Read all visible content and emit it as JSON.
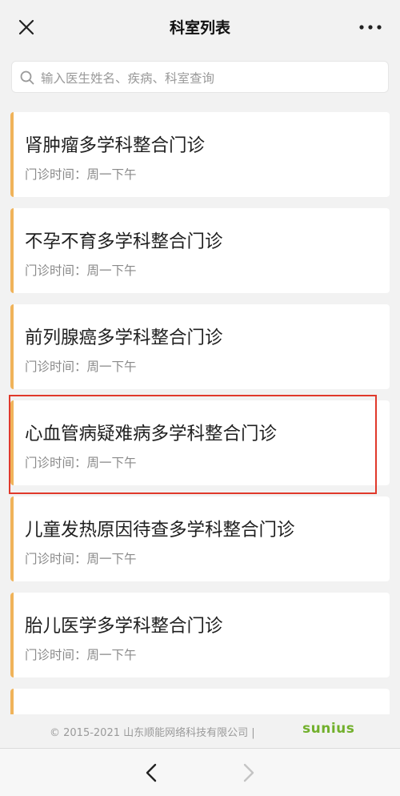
{
  "header": {
    "title": "科室列表",
    "close_icon": "close-icon",
    "more_icon": "more-dots-icon"
  },
  "search": {
    "placeholder": "输入医生姓名、疾病、科室查询",
    "icon": "search-icon"
  },
  "departments": [
    {
      "name": "肾肿瘤多学科整合门诊",
      "schedule": "门诊时间：周一下午"
    },
    {
      "name": "不孕不育多学科整合门诊",
      "schedule": "门诊时间：周一下午"
    },
    {
      "name": "前列腺癌多学科整合门诊",
      "schedule": "门诊时间：周一下午"
    },
    {
      "name": "心血管病疑难病多学科整合门诊",
      "schedule": "门诊时间：周一下午"
    },
    {
      "name": "儿童发热原因待查多学科整合门诊",
      "schedule": "门诊时间：周一下午"
    },
    {
      "name": "胎儿医学多学科整合门诊",
      "schedule": "门诊时间：周一下午"
    },
    {
      "name": "...",
      "schedule": ""
    }
  ],
  "footer": {
    "copyright": "© 2015-2021 山东顺能网络科技有限公司 |",
    "logo": "sunius"
  },
  "nav": {
    "back_icon": "chevron-left-icon",
    "forward_icon": "chevron-right-icon"
  },
  "colors": {
    "accent": "#f0b35a",
    "highlight": "#e0392b",
    "logo": "#72b02c",
    "background": "#f2f2f2"
  }
}
